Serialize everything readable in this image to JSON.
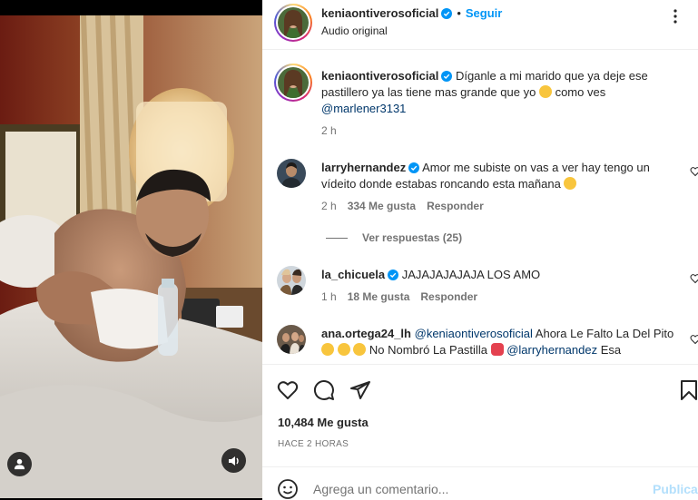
{
  "post": {
    "username": "keniaontiverosoficial",
    "separator": "•",
    "follow_label": "Seguir",
    "audio_label": "Audio original",
    "more_icon": "more-vertical-icon"
  },
  "caption": {
    "username": "keniaontiverosoficial",
    "text": "Díganle a mi marido que ya deje ese pastillero ya las tiene mas grande que yo",
    "text_after_emoji": "como ves",
    "mention": "@marlener3131",
    "time": "2 h"
  },
  "comments": [
    {
      "username": "larryhernandez",
      "text": "Amor me subiste on vas a ver hay tengo un vídeito donde estabas roncando esta mañana",
      "time": "2 h",
      "likes": "334 Me gusta",
      "reply": "Responder",
      "view_replies": "Ver respuestas (25)"
    },
    {
      "username": "la_chicuela",
      "text": "JAJAJAJAJAJA LOS AMO",
      "time": "1 h",
      "likes": "18 Me gusta",
      "reply": "Responder"
    },
    {
      "username": "ana.ortega24_lh",
      "mention1": "@keniaontiverosoficial",
      "text1": "Ahora Le Falto La Del Pito",
      "text2": "No Nombró La Pastilla",
      "mention2": "@larryhernandez",
      "text3": "Esa"
    }
  ],
  "actions": {
    "like_icon": "heart-icon",
    "comment_icon": "comment-icon",
    "share_icon": "share-icon",
    "save_icon": "bookmark-icon",
    "likes": "10,484 Me gusta",
    "date": "HACE 2 HORAS"
  },
  "add_comment": {
    "placeholder": "Agrega un comentario...",
    "post_label": "Publicar"
  },
  "colors": {
    "link": "#0095f6",
    "mention": "#00376b",
    "muted": "#737373",
    "verified": "#0095f6"
  }
}
